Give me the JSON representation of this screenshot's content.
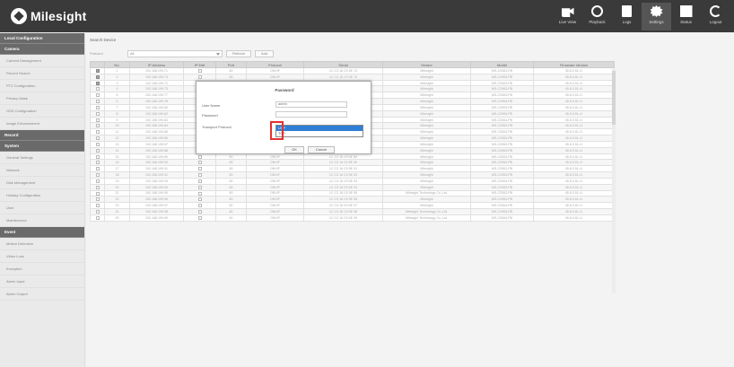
{
  "header": {
    "brand": "Milesight",
    "nav": [
      {
        "label": "Live View",
        "icon": "camera-icon"
      },
      {
        "label": "Playback",
        "icon": "playback-icon"
      },
      {
        "label": "Logs",
        "icon": "logs-icon"
      },
      {
        "label": "Settings",
        "icon": "gear-icon",
        "active": true
      },
      {
        "label": "Status",
        "icon": "status-icon"
      },
      {
        "label": "Logout",
        "icon": "logout-icon"
      }
    ]
  },
  "sidebar": {
    "groups": [
      {
        "title": "Local Configuration",
        "items": []
      },
      {
        "title": "Camera",
        "items": [
          "Camera Management",
          "Record Search",
          "PTZ Configuration",
          "Privacy Mask",
          "OSD Configuration",
          "Image Enhancement"
        ]
      },
      {
        "title": "Record",
        "items": []
      },
      {
        "title": "System",
        "items": [
          "General Settings",
          "Network",
          "Disk Management",
          "Holiday Configuration",
          "User",
          "Maintenance"
        ]
      },
      {
        "title": "Event",
        "items": [
          "Motion Detection",
          "Video Loss",
          "Exception",
          "Alarm Input",
          "Alarm Output"
        ]
      }
    ]
  },
  "main": {
    "title": "Search Device",
    "toolbar": {
      "protocol_label": "Protocol",
      "protocol_value": "All",
      "refresh_label": "Refresh",
      "add_label": "Add"
    },
    "table": {
      "columns": [
        "",
        "No.",
        "IP Address",
        "IP Edit",
        "Port",
        "Protocol",
        "Serial",
        "Vendor",
        "Model",
        "Firmware Version"
      ],
      "rows": [
        {
          "checked": true,
          "no": "1",
          "ip": "192.168.199.71",
          "port": "80",
          "protocol": "ONVIF",
          "serial": "1C C3 16 C9 5E 72",
          "vendor": "Milesight",
          "model": "MS-C5363-PB",
          "fw": "45.6.0.51-r1"
        },
        {
          "checked": true,
          "no": "2",
          "ip": "192.168.199.74",
          "port": "80",
          "protocol": "ONVIF",
          "serial": "1C C3 16 C9 5E 74",
          "vendor": "Milesight",
          "model": "MS-C2963-PB",
          "fw": "45.6.0.51-r1"
        },
        {
          "checked": true,
          "no": "3",
          "ip": "192.168.199.72",
          "port": "80",
          "protocol": "ONVIF",
          "serial": "1C C3 16 C9 5E 73",
          "vendor": "Milesight",
          "model": "MS-C5363-PB",
          "fw": "45.6.0.51-r1"
        },
        {
          "checked": false,
          "no": "4",
          "ip": "192.168.199.73",
          "port": "80",
          "protocol": "ONVIF",
          "serial": "1C C3 16 C9 5E 75",
          "vendor": "Milesight",
          "model": "MS-C2963-PB",
          "fw": "45.6.0.51-r1"
        },
        {
          "checked": false,
          "no": "5",
          "ip": "192.168.199.77",
          "port": "80",
          "protocol": "ONVIF",
          "serial": "1C C3 16 C9 5E 77",
          "vendor": "Milesight",
          "model": "MS-C5363-PB",
          "fw": "45.6.0.51-r1"
        },
        {
          "checked": false,
          "no": "6",
          "ip": "192.168.199.78",
          "port": "80",
          "protocol": "ONVIF",
          "serial": "1C C3 16 C9 5E 78",
          "vendor": "Milesight",
          "model": "MS-C2963-PB",
          "fw": "45.6.0.51-r1"
        },
        {
          "checked": false,
          "no": "7",
          "ip": "192.168.199.80",
          "port": "80",
          "protocol": "ONVIF",
          "serial": "1C C3 16 C9 5E 80",
          "vendor": "Milesight",
          "model": "MS-C5363-PB",
          "fw": "45.6.0.51-r1"
        },
        {
          "checked": false,
          "no": "8",
          "ip": "192.168.199.82",
          "port": "80",
          "protocol": "ONVIF",
          "serial": "1C C3 16 C9 5E 82",
          "vendor": "Milesight",
          "model": "MS-C2963-PB",
          "fw": "45.6.0.51-r1"
        },
        {
          "checked": false,
          "no": "9",
          "ip": "192.168.199.83",
          "port": "80",
          "protocol": "ONVIF",
          "serial": "1C C3 16 C9 5E 83",
          "vendor": "Milesight",
          "model": "MS-C5363-PB",
          "fw": "45.6.0.51-r1"
        },
        {
          "checked": false,
          "no": "10",
          "ip": "192.168.199.84",
          "port": "80",
          "protocol": "ONVIF",
          "serial": "1C C3 16 C9 5E 84",
          "vendor": "Milesight",
          "model": "MS-C2963-PB",
          "fw": "45.6.0.51-r1"
        },
        {
          "checked": false,
          "no": "11",
          "ip": "192.168.199.85",
          "port": "80",
          "protocol": "ONVIF",
          "serial": "1C C3 16 C9 5E 85",
          "vendor": "Milesight",
          "model": "MS-C5363-PB",
          "fw": "45.6.0.51-r1"
        },
        {
          "checked": false,
          "no": "12",
          "ip": "192.168.199.86",
          "port": "80",
          "protocol": "ONVIF",
          "serial": "1C C3 16 C9 5E 86",
          "vendor": "Milesight",
          "model": "MS-C2963-PB",
          "fw": "45.6.0.51-r1"
        },
        {
          "checked": false,
          "no": "13",
          "ip": "192.168.199.87",
          "port": "80",
          "protocol": "ONVIF",
          "serial": "1C C3 16 C9 5E 87",
          "vendor": "Milesight",
          "model": "MS-C5363-PB",
          "fw": "45.6.0.51-r1"
        },
        {
          "checked": false,
          "no": "14",
          "ip": "192.168.199.88",
          "port": "80",
          "protocol": "ONVIF",
          "serial": "1C C3 16 C9 5E 88",
          "vendor": "Milesight",
          "model": "MS-C2963-PB",
          "fw": "45.6.0.51-r1"
        },
        {
          "checked": false,
          "no": "15",
          "ip": "192.168.199.89",
          "port": "80",
          "protocol": "ONVIF",
          "serial": "1C C3 16 C9 5E 89",
          "vendor": "Milesight",
          "model": "MS-C5363-PB",
          "fw": "45.6.0.51-r1"
        },
        {
          "checked": false,
          "no": "16",
          "ip": "192.168.199.90",
          "port": "80",
          "protocol": "ONVIF",
          "serial": "1C C3 16 C9 5E 90",
          "vendor": "Milesight",
          "model": "MS-C2963-PB",
          "fw": "45.6.0.51-r1"
        },
        {
          "checked": false,
          "no": "17",
          "ip": "192.168.199.91",
          "port": "80",
          "protocol": "ONVIF",
          "serial": "1C C3 16 C9 5E 91",
          "vendor": "Milesight",
          "model": "MS-C5363-PB",
          "fw": "45.6.0.51-r1"
        },
        {
          "checked": false,
          "no": "18",
          "ip": "192.168.199.92",
          "port": "80",
          "protocol": "ONVIF",
          "serial": "1C C3 16 C9 5E 92",
          "vendor": "Milesight",
          "model": "MS-C2963-PB",
          "fw": "45.6.0.51-r1"
        },
        {
          "checked": false,
          "no": "19",
          "ip": "192.168.199.93",
          "port": "80",
          "protocol": "ONVIF",
          "serial": "1C C3 16 C9 5E 93",
          "vendor": "Milesight",
          "model": "MS-C5363-PB",
          "fw": "45.6.0.51-r1"
        },
        {
          "checked": false,
          "no": "20",
          "ip": "192.168.199.94",
          "port": "80",
          "protocol": "ONVIF",
          "serial": "1C C3 16 C9 5E 94",
          "vendor": "Milesight",
          "model": "MS-C2963-PB",
          "fw": "45.6.0.51-r1"
        },
        {
          "checked": false,
          "no": "21",
          "ip": "192.168.199.95",
          "port": "80",
          "protocol": "ONVIF",
          "serial": "1C C3 16 C9 5E 95",
          "vendor": "Milesight Technology Co.,Ltd.",
          "model": "MS-C5363-PB",
          "fw": "45.6.0.51-r1"
        },
        {
          "checked": false,
          "no": "22",
          "ip": "192.168.199.96",
          "port": "80",
          "protocol": "ONVIF",
          "serial": "1C C3 16 C9 5E 96",
          "vendor": "Milesight",
          "model": "MS-C2963-PB",
          "fw": "45.6.0.51-r1"
        },
        {
          "checked": false,
          "no": "23",
          "ip": "192.168.199.97",
          "port": "80",
          "protocol": "ONVIF",
          "serial": "1C C3 16 C9 5E 97",
          "vendor": "Milesight",
          "model": "MS-C5363-PB",
          "fw": "45.6.0.51-r1"
        },
        {
          "checked": false,
          "no": "24",
          "ip": "192.168.199.98",
          "port": "80",
          "protocol": "ONVIF",
          "serial": "1C C3 16 C9 5E 98",
          "vendor": "Milesight Technology Co.,Ltd.",
          "model": "MS-C2963-PB",
          "fw": "45.6.0.51-r1"
        },
        {
          "checked": false,
          "no": "25",
          "ip": "192.168.199.99",
          "port": "80",
          "protocol": "ONVIF",
          "serial": "1C C3 16 C9 5E 99",
          "vendor": "Milesight Technology Co.,Ltd.",
          "model": "MS-C5363-PB",
          "fw": "45.6.0.51-r1"
        }
      ]
    }
  },
  "dialog": {
    "title": "Password",
    "user_name_label": "User Name",
    "user_name_value": "admin",
    "password_label": "Password",
    "transport_label": "Transport Protocol",
    "transport_options": [
      "UDP",
      "TCP"
    ],
    "selected_option": "UDP",
    "ok_label": "OK",
    "cancel_label": "Cancel"
  }
}
